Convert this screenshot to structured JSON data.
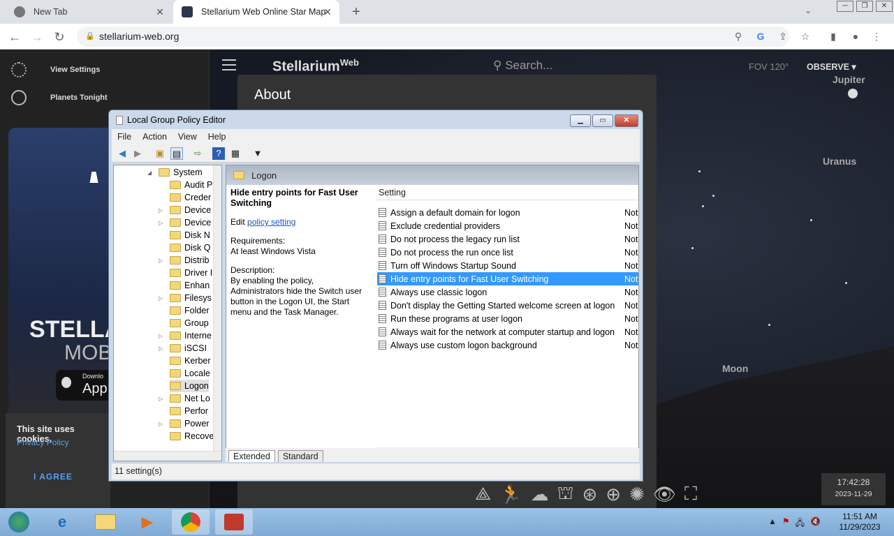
{
  "browser": {
    "tabs": [
      {
        "title": "New Tab"
      },
      {
        "title": "Stellarium Web Online Star Map"
      }
    ],
    "url": "stellarium-web.org"
  },
  "stellarium": {
    "sidebar": {
      "view_settings": "View Settings",
      "planets_tonight": "Planets Tonight"
    },
    "promo": {
      "title": "STELLA",
      "subtitle": "MOB",
      "download": "Downlo",
      "app": "App"
    },
    "cookie": {
      "text": "This site uses cookies.",
      "link": "Privacy Policy",
      "agree": "I AGREE"
    },
    "logo": "Stellarium",
    "logo_sup": "Web",
    "search_placeholder": "Search...",
    "fov": "FOV 120°",
    "observe": "OBSERVE",
    "about_title": "About",
    "planets": [
      "Jupiter",
      "Uranus",
      "Moon"
    ],
    "time": "17:42:28",
    "date": "2023-11-29"
  },
  "gpo": {
    "title": "Local Group Policy Editor",
    "menu": [
      "File",
      "Action",
      "View",
      "Help"
    ],
    "tree": {
      "root": "System",
      "items": [
        "Audit P",
        "Creder",
        "Device",
        "Device",
        "Disk N",
        "Disk Q",
        "Distrib",
        "Driver I",
        "Enhan",
        "Filesys",
        "Folder",
        "Group",
        "Interne",
        "iSCSI",
        "Kerber",
        "Locale",
        "Logon",
        "Net Lo",
        "Perfor",
        "Power",
        "Recove"
      ]
    },
    "folder_header": "Logon",
    "detail": {
      "heading": "Hide entry points for Fast User Switching",
      "edit_prefix": "Edit",
      "edit_link": "policy setting",
      "req_label": "Requirements:",
      "req_value": "At least Windows Vista",
      "desc_label": "Description:",
      "desc_text": "By enabling the policy, Administrators hide the Switch user button in the Logon UI, the Start menu and the Task Manager."
    },
    "list": {
      "column": "Setting",
      "rows": [
        {
          "name": "Assign a default domain for logon",
          "state": "Not"
        },
        {
          "name": "Exclude credential providers",
          "state": "Not"
        },
        {
          "name": "Do not process the legacy run list",
          "state": "Not"
        },
        {
          "name": "Do not process the run once list",
          "state": "Not"
        },
        {
          "name": "Turn off Windows Startup Sound",
          "state": "Not"
        },
        {
          "name": "Hide entry points for Fast User Switching",
          "state": "Not"
        },
        {
          "name": "Always use classic logon",
          "state": "Not"
        },
        {
          "name": "Don't display the Getting Started welcome screen at logon",
          "state": "Not"
        },
        {
          "name": "Run these programs at user logon",
          "state": "Not"
        },
        {
          "name": "Always wait for the network at computer startup and logon",
          "state": "Not"
        },
        {
          "name": "Always use custom logon background",
          "state": "Not"
        }
      ]
    },
    "tabs": [
      "Extended",
      "Standard"
    ],
    "status": "11 setting(s)"
  },
  "taskbar": {
    "time": "11:51 AM",
    "date": "11/29/2023"
  }
}
